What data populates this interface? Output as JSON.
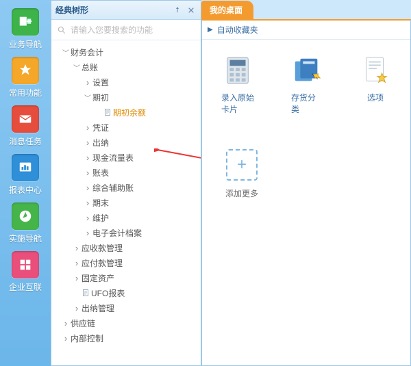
{
  "rail": {
    "items": [
      {
        "label": "业务导航",
        "bg": "#3db34a"
      },
      {
        "label": "常用功能",
        "bg": "#f4a728"
      },
      {
        "label": "消息任务",
        "bg": "#e64d3d"
      },
      {
        "label": "报表中心",
        "bg": "#2f8fd8"
      },
      {
        "label": "实施导航",
        "bg": "#46b549"
      },
      {
        "label": "企业互联",
        "bg": "#e94f7a"
      }
    ]
  },
  "panel": {
    "title": "经典树形",
    "search_placeholder": "请输入您要搜索的功能"
  },
  "tree": [
    {
      "d": 0,
      "exp": "open",
      "label": "财务会计"
    },
    {
      "d": 1,
      "exp": "open",
      "label": "总账"
    },
    {
      "d": 2,
      "exp": "closed",
      "label": "设置"
    },
    {
      "d": 2,
      "exp": "open",
      "label": "期初"
    },
    {
      "d": 3,
      "exp": "leaf",
      "label": "期初余额",
      "sel": true
    },
    {
      "d": 2,
      "exp": "closed",
      "label": "凭证"
    },
    {
      "d": 2,
      "exp": "closed",
      "label": "出纳"
    },
    {
      "d": 2,
      "exp": "closed",
      "label": "现金流量表"
    },
    {
      "d": 2,
      "exp": "closed",
      "label": "账表"
    },
    {
      "d": 2,
      "exp": "closed",
      "label": "综合辅助账"
    },
    {
      "d": 2,
      "exp": "closed",
      "label": "期末"
    },
    {
      "d": 2,
      "exp": "closed",
      "label": "维护"
    },
    {
      "d": 2,
      "exp": "closed",
      "label": "电子会计档案"
    },
    {
      "d": 1,
      "exp": "closed",
      "label": "应收款管理"
    },
    {
      "d": 1,
      "exp": "closed",
      "label": "应付款管理"
    },
    {
      "d": 1,
      "exp": "closed",
      "label": "固定资产"
    },
    {
      "d": 1,
      "exp": "leaf",
      "label": "UFO报表"
    },
    {
      "d": 1,
      "exp": "closed",
      "label": "出纳管理"
    },
    {
      "d": 0,
      "exp": "closed",
      "label": "供应链"
    },
    {
      "d": 0,
      "exp": "closed",
      "label": "内部控制"
    }
  ],
  "desktop": {
    "tab": "我的桌面",
    "fav": "自动收藏夹",
    "cards": [
      {
        "label": "录入原始卡片"
      },
      {
        "label": "存货分类"
      },
      {
        "label": "选项"
      }
    ],
    "more": "添加更多"
  }
}
